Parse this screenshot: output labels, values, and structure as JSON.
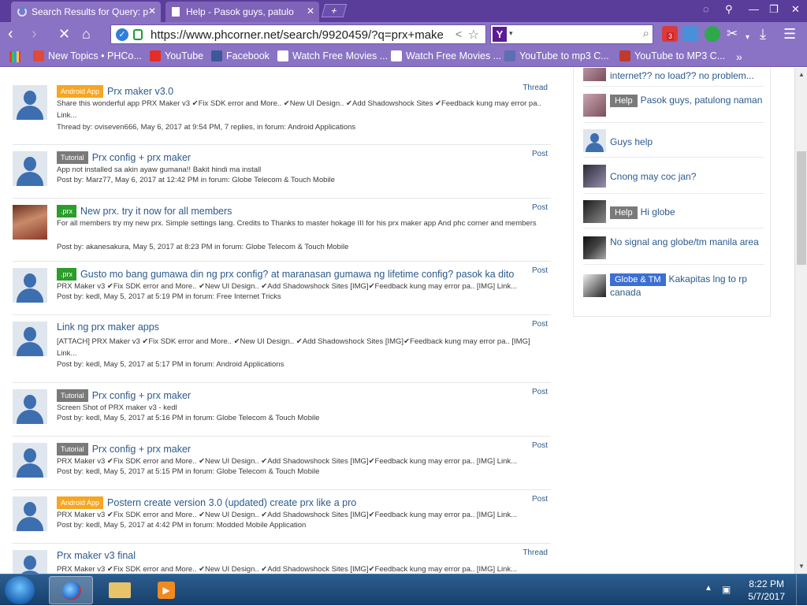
{
  "browser": {
    "tabs": [
      {
        "label": "Search Results for Query: p",
        "active": true
      },
      {
        "label": "Help - Pasok guys, patulo",
        "active": false
      }
    ],
    "url": "https://www.phcorner.net/search/9920459/?q=prx+make",
    "search_placeholder": "",
    "badge_count": "3"
  },
  "bookmarks": [
    {
      "label": "New Topics • PHCo...",
      "icon": "phcorner-icon"
    },
    {
      "label": "YouTube",
      "icon": "youtube-icon"
    },
    {
      "label": "Facebook",
      "icon": "facebook-icon"
    },
    {
      "label": "Watch Free Movies ...",
      "icon": "page-icon"
    },
    {
      "label": "Watch Free Movies ...",
      "icon": "page-icon"
    },
    {
      "label": "YouTube to mp3 C...",
      "icon": "mp3-icon"
    },
    {
      "label": "YouTube to MP3 C...",
      "icon": "youtube-mp3-icon"
    }
  ],
  "results": [
    {
      "prefix": "Android App",
      "prefix_color": "orange",
      "title": "Prx maker v3.0",
      "type": "Thread",
      "snippet": "Share this wonderful app PRX Maker v3 ✔Fix SDK error and More.. ✔New UI Design.. ✔Add Shadowshock Sites ✔Feedback kung may error pa.. Link...",
      "meta": "Thread by: oviseven666, May 6, 2017 at 9:54 PM, 7 replies, in forum: Android Applications",
      "avatar": "default"
    },
    {
      "prefix": "Tutorial",
      "prefix_color": "gray",
      "title": "Prx config + prx maker",
      "type": "Post",
      "snippet": "App not installed sa akin ayaw gumana!! Bakit hindi ma install",
      "meta": "Post by: Marz77, May 6, 2017 at 12:42 PM in forum: Globe Telecom & Touch Mobile",
      "avatar": "default"
    },
    {
      "prefix": ".prx",
      "prefix_color": "green",
      "title": "New prx. try it now for all members",
      "type": "Post",
      "snippet": "For all members try my new prx. Simple settings lang. Credits to Thanks to master hokage III for his prx maker app And phc corner and members",
      "meta": "Post by: akanesakura, May 5, 2017 at 8:23 PM in forum: Globe Telecom & Touch Mobile",
      "avatar": "anime"
    },
    {
      "prefix": ".prx",
      "prefix_color": "green",
      "title": "Gusto mo bang gumawa din ng prx config? at maranasan gumawa ng lifetime config? pasok ka dito",
      "type": "Post",
      "snippet": "PRX Maker v3 ✔Fix SDK error and More.. ✔New UI Design.. ✔Add Shadowshock Sites [IMG]✔Feedback kung may error pa.. [IMG] Link...",
      "meta": "Post by: kedl, May 5, 2017 at 5:19 PM in forum: Free Internet Tricks",
      "avatar": "default"
    },
    {
      "prefix": "",
      "prefix_color": "",
      "title": "Link ng prx maker apps",
      "type": "Post",
      "snippet": "[ATTACH] PRX Maker v3 ✔Fix SDK error and More.. ✔New UI Design.. ✔Add Shadowshock Sites [IMG]✔Feedback kung may error pa.. [IMG] Link...",
      "meta": "Post by: kedl, May 5, 2017 at 5:17 PM in forum: Android Applications",
      "avatar": "default"
    },
    {
      "prefix": "Tutorial",
      "prefix_color": "gray",
      "title": "Prx config + prx maker",
      "type": "Post",
      "snippet": "Screen Shot of PRX maker v3 - kedl",
      "meta": "Post by: kedl, May 5, 2017 at 5:16 PM in forum: Globe Telecom & Touch Mobile",
      "avatar": "default"
    },
    {
      "prefix": "Tutorial",
      "prefix_color": "gray",
      "title": "Prx config + prx maker",
      "type": "Post",
      "snippet": "PRX Maker v3 ✔Fix SDK error and More.. ✔New UI Design.. ✔Add Shadowshock Sites [IMG]✔Feedback kung may error pa.. [IMG] Link...",
      "meta": "Post by: kedl, May 5, 2017 at 5:15 PM in forum: Globe Telecom & Touch Mobile",
      "avatar": "default"
    },
    {
      "prefix": "Android App",
      "prefix_color": "orange",
      "title": "Postern create version 3.0 (updated) create prx like a pro",
      "type": "Post",
      "snippet": "PRX Maker v3 ✔Fix SDK error and More.. ✔New UI Design.. ✔Add Shadowshock Sites [IMG]✔Feedback kung may error pa.. [IMG] Link...",
      "meta": "Post by: kedl, May 5, 2017 at 4:42 PM in forum: Modded Mobile Application",
      "avatar": "default"
    },
    {
      "prefix": "",
      "prefix_color": "",
      "title": "Prx maker v3 final",
      "type": "Thread",
      "snippet": "PRX Maker v3 ✔Fix SDK error and More.. ✔New UI Design.. ✔Add Shadowshock Sites [IMG]✔Feedback kung may error pa.. [IMG] Link...",
      "meta": "",
      "avatar": "default"
    }
  ],
  "sidebar": [
    {
      "prefix": "",
      "prefix_color": "",
      "text": "internet?? no load?? no problem...",
      "avatar": "pic1"
    },
    {
      "prefix": "Help",
      "prefix_color": "gray",
      "text": "Pasok guys, patulong naman",
      "avatar": "pic1"
    },
    {
      "prefix": "",
      "prefix_color": "",
      "text": "Guys help",
      "avatar": "default"
    },
    {
      "prefix": "",
      "prefix_color": "",
      "text": "Cnong may coc jan?",
      "avatar": "pic2"
    },
    {
      "prefix": "Help",
      "prefix_color": "gray",
      "text": "Hi globe",
      "avatar": "pic3"
    },
    {
      "prefix": "",
      "prefix_color": "",
      "text": "No signal ang globe/tm manila area",
      "avatar": "pic4"
    },
    {
      "prefix": "Globe & TM",
      "prefix_color": "blue",
      "text": "Kakapitas lng to rp canada",
      "avatar": "pic5"
    }
  ],
  "taskbar": {
    "time": "8:22 PM",
    "date": "5/7/2017"
  },
  "colors": {
    "titlebar": "#5a3d9a",
    "toolbar": "#8a73c4",
    "link": "#2b5a8c",
    "prefix_orange": "#f5a623",
    "prefix_gray": "#7a7a7a",
    "prefix_green": "#2a9d2a",
    "prefix_blue": "#3b6fd4"
  }
}
